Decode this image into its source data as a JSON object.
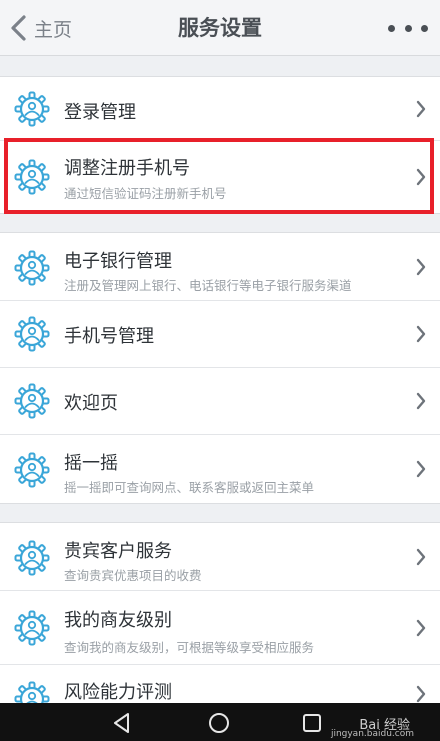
{
  "header": {
    "back_label": "主页",
    "title": "服务设置",
    "icons": {
      "back": "chevron-left-icon",
      "more": "more-dots-icon"
    }
  },
  "colors": {
    "accent": "#3aa6d8",
    "highlight_border": "#e8202a",
    "text": "#2e3338",
    "subtext": "#9aa0a6"
  },
  "groups": [
    {
      "items": [
        {
          "label": "登录管理",
          "sub": "",
          "icon": "gear-user-icon"
        },
        {
          "label": "调整注册手机号",
          "sub": "通过短信验证码注册新手机号",
          "icon": "gear-user-icon"
        }
      ]
    },
    {
      "items": [
        {
          "label": "电子银行管理",
          "sub": "注册及管理网上银行、电话银行等电子银行服务渠道",
          "icon": "gear-user-icon"
        },
        {
          "label": "手机号管理",
          "sub": "",
          "icon": "gear-user-icon"
        },
        {
          "label": "欢迎页",
          "sub": "",
          "icon": "gear-user-icon"
        },
        {
          "label": "摇一摇",
          "sub": "摇一摇即可查询网点、联系客服或返回主菜单",
          "icon": "gear-user-icon"
        }
      ]
    },
    {
      "items": [
        {
          "label": "贵宾客户服务",
          "sub": "查询贵宾优惠项目的收费",
          "icon": "gear-user-icon"
        },
        {
          "label": "我的商友级别",
          "sub": "查询我的商友级别，可根据等级享受相应服务",
          "icon": "gear-user-icon"
        },
        {
          "label": "风险能力评测",
          "sub": "",
          "icon": "gear-user-icon"
        }
      ]
    }
  ],
  "navbar": {
    "icons": [
      "back-triangle-icon",
      "home-circle-icon",
      "recent-square-icon"
    ],
    "watermark": "Bai 经验",
    "watermark_sub": "jingyan.baidu.com"
  }
}
